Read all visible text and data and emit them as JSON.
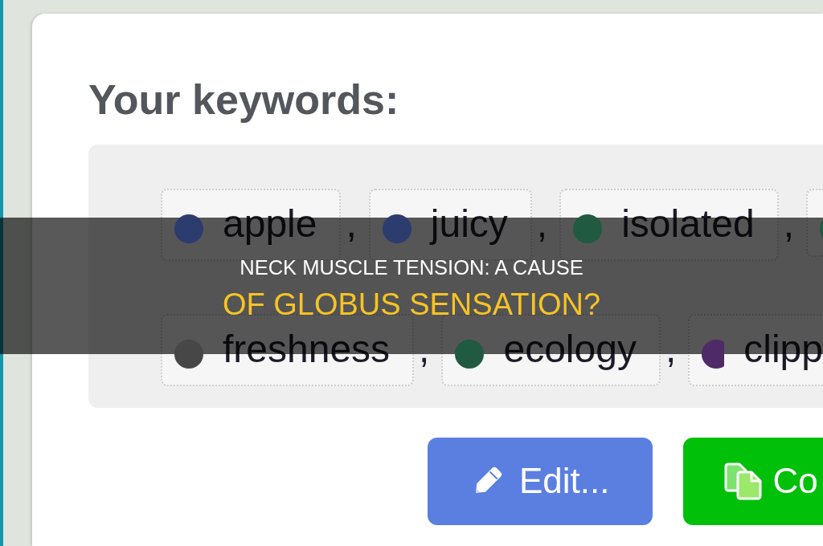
{
  "keywords_panel": {
    "heading": "Your keywords:",
    "rows": [
      {
        "keywords": [
          {
            "word": "apple",
            "separator": ",",
            "color": "#2d3c6e"
          },
          {
            "word": "juicy",
            "separator": ",",
            "color": "#2d3c6e"
          },
          {
            "word": "isolated",
            "separator": ",",
            "color": "#1f5a41"
          },
          {
            "color": "#1f5a41"
          }
        ]
      },
      {
        "keywords": [
          {
            "word": "freshness",
            "separator": ",",
            "color": "#474747"
          },
          {
            "word": "ecology",
            "separator": ",",
            "color": "#1f5a41"
          },
          {
            "word": "clipp",
            "color": "#4e2a66"
          }
        ]
      }
    ]
  },
  "buttons": [
    {
      "kind": "edit",
      "label": "Edit..."
    },
    {
      "kind": "copy",
      "label": "Co"
    }
  ],
  "title_banner": {
    "lines": [
      {
        "kind": "lead",
        "text": "NECK MUSCLE TENSION: A CAUSE"
      },
      {
        "kind": "highlight",
        "text": "OF GLOBUS SENSATION?"
      }
    ]
  }
}
